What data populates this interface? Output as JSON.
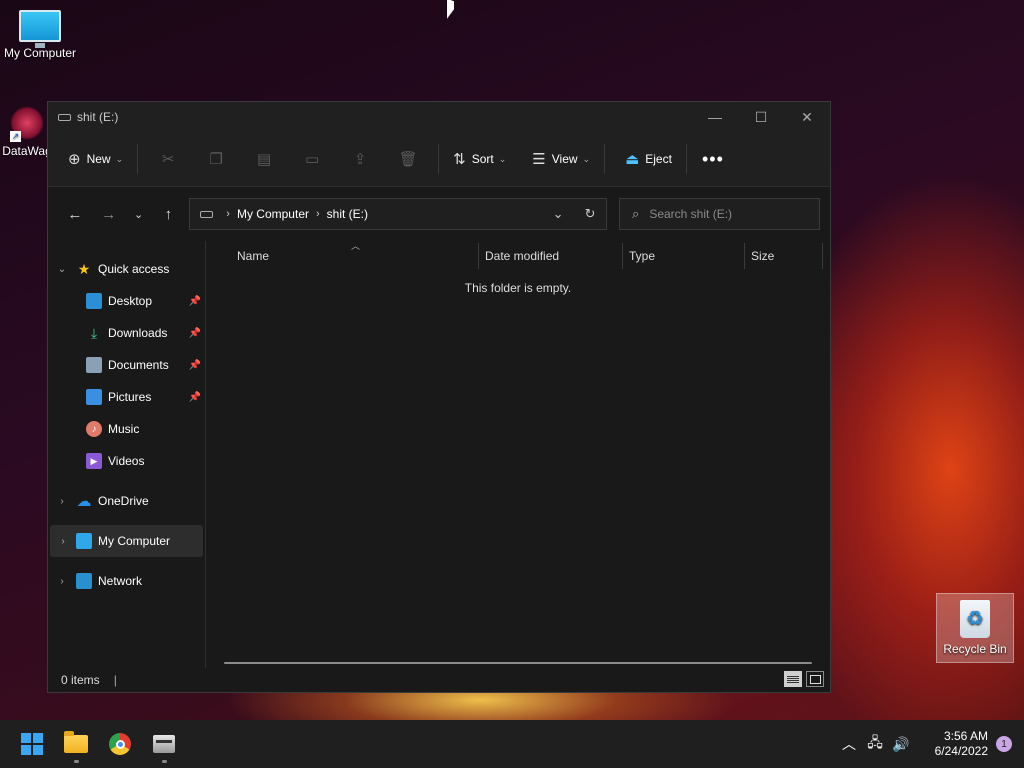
{
  "desktop": {
    "icons": [
      {
        "label": "My Computer"
      },
      {
        "label": "DataWag"
      },
      {
        "label": "Recycle Bin"
      }
    ]
  },
  "window": {
    "title": "shit (E:)",
    "controls": {
      "minimize": "—",
      "maximize": "☐",
      "close": "✕"
    }
  },
  "toolbar": {
    "new_label": "New",
    "sort_label": "Sort",
    "view_label": "View",
    "eject_label": "Eject",
    "more_label": "•••"
  },
  "address": {
    "crumbs": [
      "My Computer",
      "shit (E:)"
    ],
    "search_placeholder": "Search shit (E:)"
  },
  "sidebar": {
    "items": [
      {
        "label": "Quick access"
      },
      {
        "label": "Desktop"
      },
      {
        "label": "Downloads"
      },
      {
        "label": "Documents"
      },
      {
        "label": "Pictures"
      },
      {
        "label": "Music"
      },
      {
        "label": "Videos"
      },
      {
        "label": "OneDrive"
      },
      {
        "label": "My Computer"
      },
      {
        "label": "Network"
      }
    ]
  },
  "columns": [
    "Name",
    "Date modified",
    "Type",
    "Size"
  ],
  "content": {
    "empty_message": "This folder is empty."
  },
  "status": {
    "items_count": "0 items"
  },
  "taskbar": {
    "time": "3:56 AM",
    "date": "6/24/2022",
    "notification_count": "1"
  },
  "colors": {
    "accent": "#3aa6f4",
    "window_bg": "#191919",
    "toolbar_bg": "#202020",
    "taskbar_bg": "#1f1f1f"
  }
}
